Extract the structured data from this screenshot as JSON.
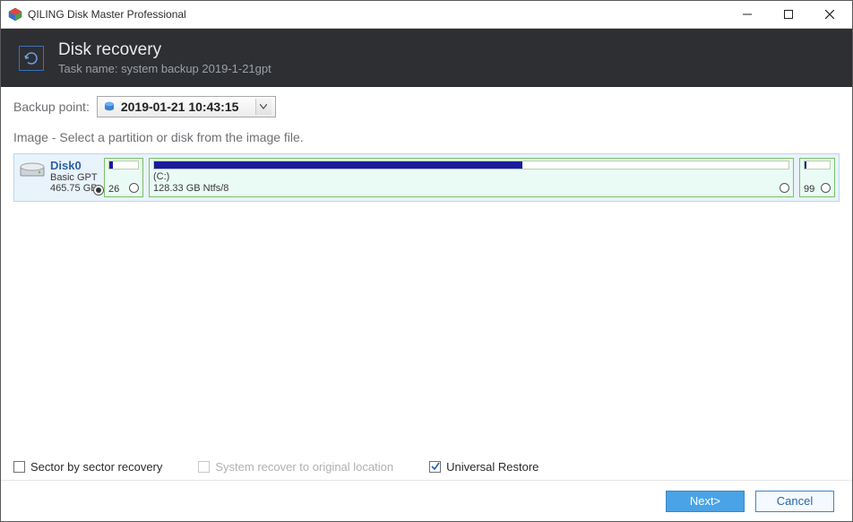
{
  "titlebar": {
    "title": "QILING Disk Master Professional"
  },
  "header": {
    "title": "Disk recovery",
    "subtitle": "Task name: system backup 2019-1-21gpt"
  },
  "backup_point": {
    "label": "Backup point:",
    "selected": "2019-01-21 10:43:15"
  },
  "instruction": "Image - Select a partition or disk from the image file.",
  "disk": {
    "name": "Disk0",
    "type": "Basic GPT",
    "size": "465.75 GB",
    "selected": true,
    "partitions": [
      {
        "label": "",
        "size_text": "26",
        "fill_pct": 12
      },
      {
        "label": "(C:)",
        "size_text": "128.33 GB Ntfs/8",
        "fill_pct": 58
      },
      {
        "label": "",
        "size_text": "99",
        "fill_pct": 8
      }
    ]
  },
  "options": {
    "sector": {
      "label": "Sector by sector recovery",
      "checked": false,
      "enabled": true
    },
    "system_orig": {
      "label": "System recover to original location",
      "checked": false,
      "enabled": false
    },
    "universal": {
      "label": "Universal Restore",
      "checked": true,
      "enabled": true
    }
  },
  "footer": {
    "next": "Next>",
    "cancel": "Cancel"
  }
}
